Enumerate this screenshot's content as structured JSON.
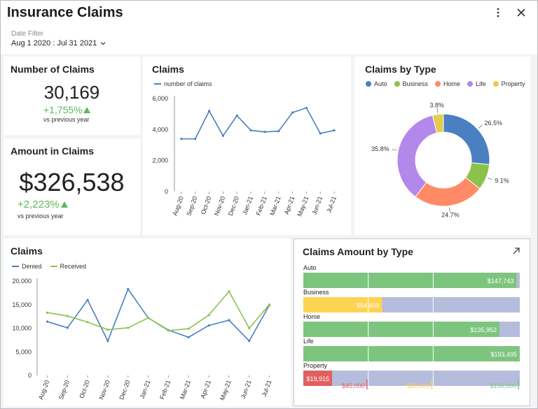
{
  "header": {
    "title": "Insurance Claims",
    "date_filter_label": "Date Filter",
    "date_filter_value": "Aug 1 2020 : Jul 31 2021"
  },
  "kpi_claims": {
    "title": "Number of Claims",
    "value": "30,169",
    "delta": "+1,755%",
    "sub": "vs previous year"
  },
  "kpi_amount": {
    "title": "Amount in Claims",
    "value": "$326,538",
    "delta": "+2,223%",
    "sub": "vs previous year"
  },
  "colors": {
    "blue": "#4a7fc1",
    "green": "#8bc34a",
    "positive": "#5cb85c",
    "auto": "#4a7fc1",
    "business": "#8bc34a",
    "home": "#ff8a65",
    "life": "#b388eb",
    "property": "#e3cc4f",
    "bar_green": "#7dc57e",
    "bar_yellow": "#fdd452",
    "bar_red": "#e15f5f",
    "bar_bg": "#b6bcdc"
  },
  "chart_claims_line": {
    "title": "Claims",
    "legend": "number of claims",
    "chart_data": {
      "type": "line",
      "categories": [
        "Aug-20",
        "Sep-20",
        "Oct-20",
        "Nov-20",
        "Dec-20",
        "Jan-21",
        "Feb-21",
        "Mar-21",
        "Apr-21",
        "May-21",
        "Jun-21",
        "Jul-21"
      ],
      "series": [
        {
          "name": "number of claims",
          "values": [
            3400,
            3400,
            5200,
            3600,
            4900,
            3950,
            3850,
            3900,
            5100,
            5400,
            3750,
            3950
          ]
        }
      ],
      "y_ticks": [
        "0",
        "2,000",
        "4,000",
        "6,000"
      ],
      "ylim": [
        0,
        6000
      ]
    }
  },
  "chart_claims_by_type": {
    "title": "Claims by Type",
    "chart_data": {
      "type": "pie",
      "labels": [
        "Auto",
        "Business",
        "Home",
        "Life",
        "Property"
      ],
      "values": [
        26.5,
        9.1,
        24.7,
        35.8,
        3.8
      ],
      "value_labels": [
        "26.5%",
        "9.1%",
        "24.7%",
        "35.8%",
        "3.8%"
      ]
    }
  },
  "chart_claims_dual": {
    "title": "Claims",
    "legend": [
      "Denied",
      "Received"
    ],
    "chart_data": {
      "type": "line",
      "categories": [
        "Aug-20",
        "Sep-20",
        "Oct-20",
        "Nov-20",
        "Dec-20",
        "Jan-21",
        "Feb-21",
        "Mar-21",
        "Apr-21",
        "May-21",
        "Jun-21",
        "Jul-21"
      ],
      "series": [
        {
          "name": "Denied",
          "values": [
            11400,
            10100,
            16000,
            7300,
            18300,
            12200,
            9600,
            8100,
            10600,
            11700,
            7300,
            14900
          ]
        },
        {
          "name": "Received",
          "values": [
            13300,
            12600,
            11300,
            9700,
            10100,
            12200,
            9500,
            9900,
            12800,
            17800,
            10000,
            15000
          ]
        }
      ],
      "y_ticks": [
        "0",
        "5,000",
        "10,000",
        "15,000",
        "20,000"
      ],
      "ylim": [
        0,
        20000
      ]
    }
  },
  "chart_amount_by_type": {
    "title": "Claims Amount by Type",
    "chart_data": {
      "type": "bar",
      "categories": [
        "Auto",
        "Business",
        "Home",
        "Life",
        "Property"
      ],
      "values": [
        147743,
        54609,
        135952,
        193495,
        19915
      ],
      "value_labels": [
        "$147,743",
        "$54,609",
        "$135,952",
        "$193,495",
        "$19,915"
      ],
      "xlim": [
        0,
        150000
      ],
      "thresholds": [
        45000,
        90000,
        150000
      ],
      "threshold_labels": [
        "$45,000",
        "$90,000",
        "$150,000"
      ]
    }
  }
}
